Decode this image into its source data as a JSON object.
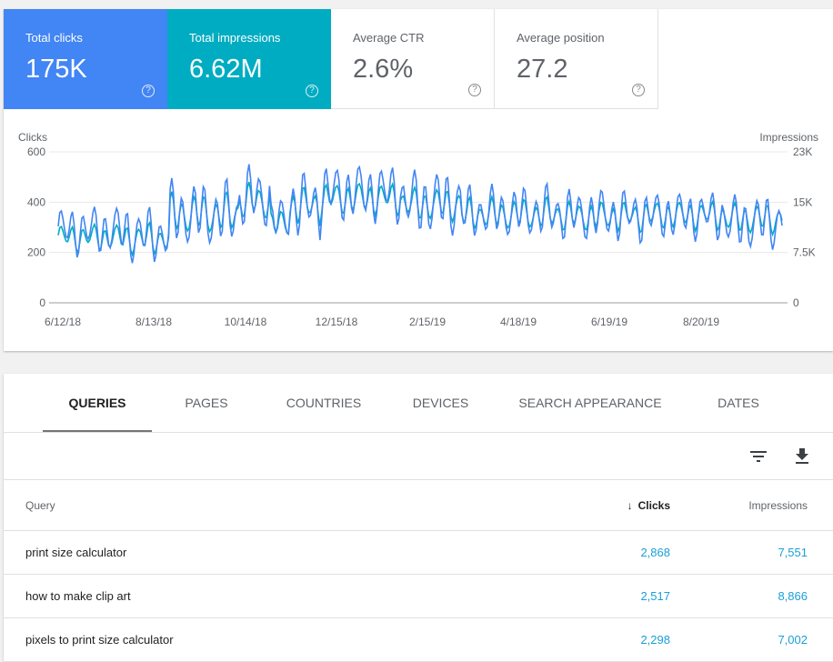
{
  "metrics": [
    {
      "label": "Total clicks",
      "value": "175K",
      "help": "?"
    },
    {
      "label": "Total impressions",
      "value": "6.62M",
      "help": "?"
    },
    {
      "label": "Average CTR",
      "value": "2.6%",
      "help": "?"
    },
    {
      "label": "Average position",
      "value": "27.2",
      "help": "?"
    }
  ],
  "colors": {
    "clicks": "#4285f4",
    "impressions": "#00acc1",
    "link": "#1a9fd8"
  },
  "chart_data": {
    "type": "line",
    "left_axis_label": "Clicks",
    "right_axis_label": "Impressions",
    "left_ticks": [
      "0",
      "200",
      "400",
      "600"
    ],
    "right_ticks": [
      "0",
      "7.5K",
      "15K",
      "23K"
    ],
    "left_ylim": [
      0,
      600
    ],
    "right_ylim": [
      0,
      23000
    ],
    "x_tick_labels": [
      "6/12/18",
      "8/13/18",
      "10/14/18",
      "12/15/18",
      "2/15/19",
      "4/18/19",
      "6/19/19",
      "8/20/19"
    ],
    "grid": true,
    "series": [
      {
        "name": "Clicks",
        "axis": "left",
        "period": 7,
        "segments": [
          [
            0,
            290,
            140
          ],
          [
            35,
            270,
            160
          ],
          [
            55,
            350,
            190
          ],
          [
            90,
            420,
            180
          ],
          [
            105,
            330,
            120
          ],
          [
            115,
            390,
            190
          ],
          [
            130,
            440,
            170
          ],
          [
            170,
            400,
            190
          ],
          [
            200,
            360,
            150
          ],
          [
            250,
            350,
            150
          ],
          [
            290,
            350,
            140
          ],
          [
            330,
            320,
            160
          ]
        ]
      },
      {
        "name": "Impressions",
        "axis": "right",
        "period": 7,
        "segments": [
          [
            0,
            10000,
            3000
          ],
          [
            35,
            9800,
            3500
          ],
          [
            55,
            13500,
            4500
          ],
          [
            90,
            15500,
            4000
          ],
          [
            105,
            12000,
            3000
          ],
          [
            115,
            14800,
            4200
          ],
          [
            130,
            16000,
            3600
          ],
          [
            170,
            15000,
            3800
          ],
          [
            200,
            13500,
            3500
          ],
          [
            250,
            13200,
            3300
          ],
          [
            290,
            13400,
            3200
          ],
          [
            330,
            12800,
            3500
          ]
        ]
      }
    ]
  },
  "tabs": [
    "QUERIES",
    "PAGES",
    "COUNTRIES",
    "DEVICES",
    "SEARCH APPEARANCE",
    "DATES"
  ],
  "active_tab": "QUERIES",
  "toolbar": {
    "filter_icon": "filter-icon",
    "download_icon": "download-icon"
  },
  "table": {
    "headers": {
      "query": "Query",
      "clicks": "Clicks",
      "impressions": "Impressions",
      "sort_arrow": "↓"
    },
    "rows": [
      {
        "query": "print size calculator",
        "clicks": "2,868",
        "impressions": "7,551"
      },
      {
        "query": "how to make clip art",
        "clicks": "2,517",
        "impressions": "8,866"
      },
      {
        "query": "pixels to print size calculator",
        "clicks": "2,298",
        "impressions": "7,002"
      }
    ]
  }
}
